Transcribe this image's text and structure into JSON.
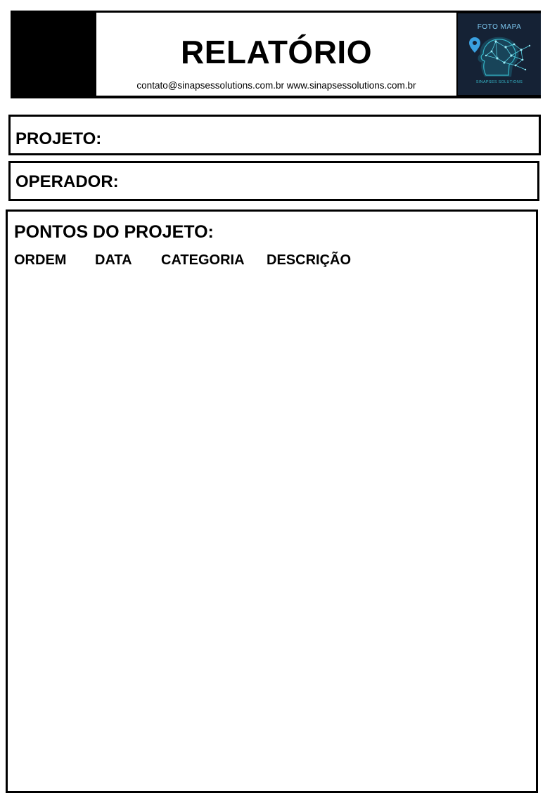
{
  "header": {
    "title": "RELATÓRIO",
    "contact": "contato@sinapsessolutions.com.br www.sinapsessolutions.com.br",
    "logo": {
      "top_text": "FOTO MAPA",
      "bottom_text": "SINAPSES SOLUTIONS",
      "icon": "head-network-map-pin-icon",
      "colors": {
        "background": "#152235",
        "accent": "#36b7c9",
        "pin": "#3aa0e0"
      }
    }
  },
  "fields": {
    "projeto_label": "PROJETO:",
    "operador_label": "OPERADOR:"
  },
  "pontos": {
    "title": "PONTOS DO PROJETO:",
    "columns": [
      "ORDEM",
      "DATA",
      "CATEGORIA",
      "DESCRIÇÃO"
    ],
    "rows": []
  }
}
